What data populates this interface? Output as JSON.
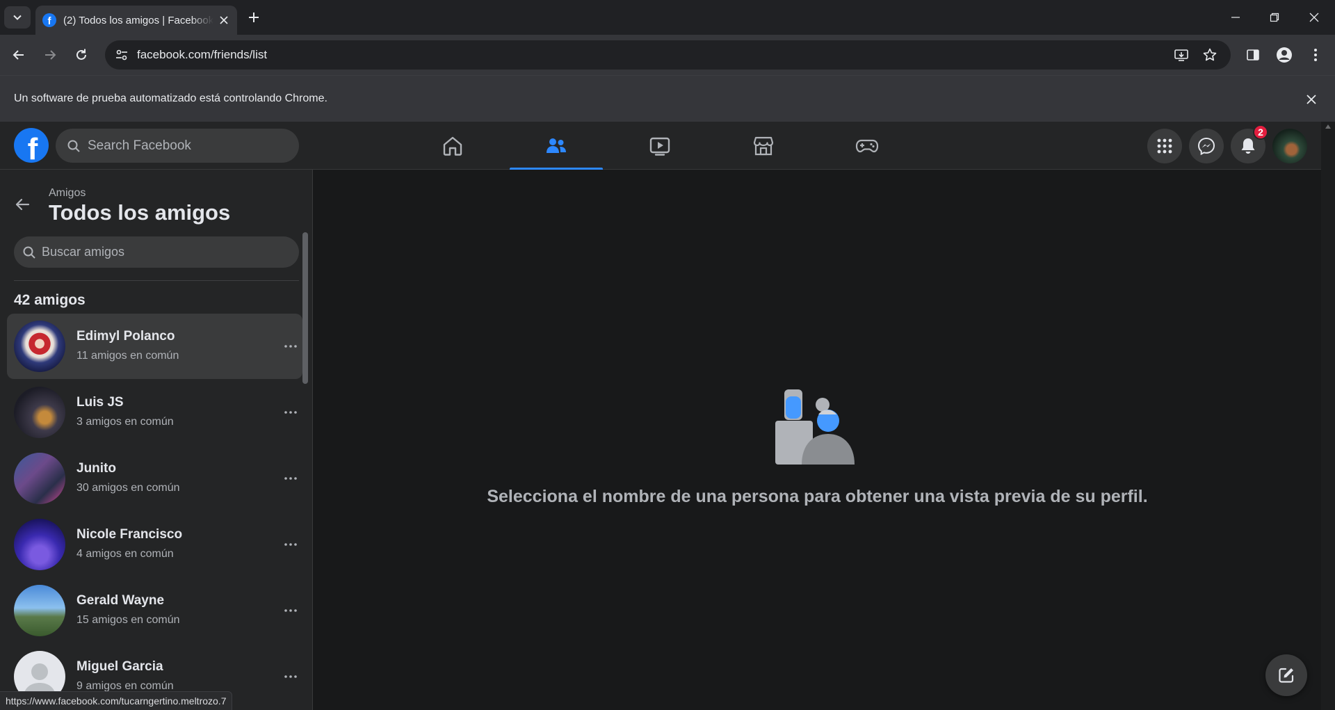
{
  "browser": {
    "tab_title": "(2) Todos los amigos | Facebook",
    "url": "facebook.com/friends/list",
    "infobar_text": "Un software de prueba automatizado está controlando Chrome.",
    "status_url": "https://www.facebook.com/tucarngertino.meltrozo.7"
  },
  "header": {
    "search_placeholder": "Search Facebook",
    "nav": [
      "home-icon",
      "friends-icon",
      "watch-icon",
      "marketplace-icon",
      "gaming-icon"
    ],
    "active_nav": "friends",
    "notification_count": "2",
    "accent": "#2d88ff"
  },
  "sidebar": {
    "breadcrumb": "Amigos",
    "title": "Todos los amigos",
    "search_placeholder": "Buscar amigos",
    "count_label": "42 amigos",
    "friends": [
      {
        "name": "Edimyl Polanco",
        "mutual": "11 amigos en común"
      },
      {
        "name": "Luis JS",
        "mutual": "3 amigos en común"
      },
      {
        "name": "Junito",
        "mutual": "30 amigos en común"
      },
      {
        "name": "Nicole Francisco",
        "mutual": "4 amigos en común"
      },
      {
        "name": "Gerald Wayne",
        "mutual": "15 amigos en común"
      },
      {
        "name": "Miguel Garcia",
        "mutual": "9 amigos en común"
      }
    ]
  },
  "main": {
    "empty_message": "Selecciona el nombre de una persona para obtener una vista previa de su perfil."
  }
}
